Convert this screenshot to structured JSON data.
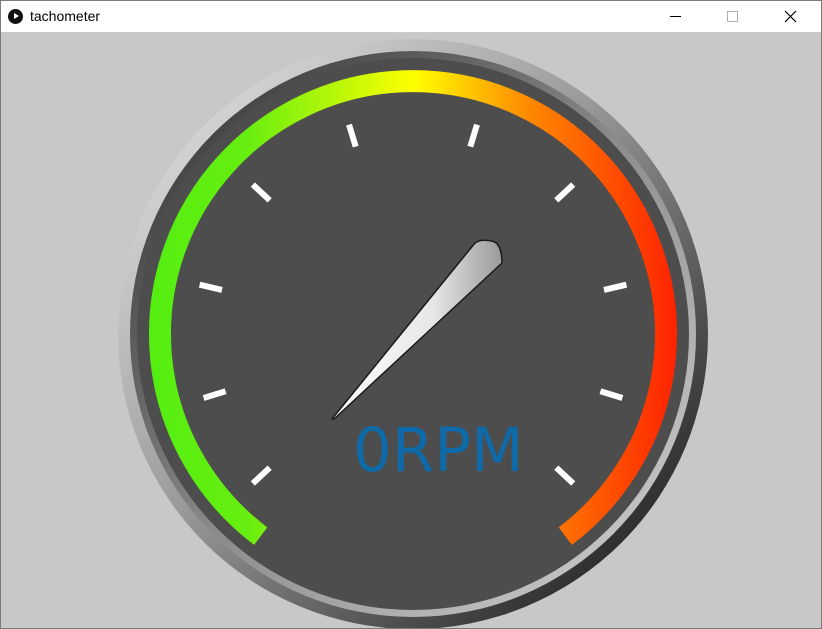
{
  "window": {
    "title": "tachometer",
    "app_icon": "play-circle-icon",
    "controls": {
      "minimize_icon": "minimize-icon",
      "maximize_icon": "maximize-icon",
      "close_icon": "close-icon"
    }
  },
  "gauge": {
    "readout": "0RPM",
    "readout_color": "#0e6aa8",
    "face_color": "#4d4d4d",
    "arc_colors": [
      "#55ee11",
      "#ffff00",
      "#ff8800",
      "#ff2200"
    ],
    "tick_color": "#ffffff"
  }
}
